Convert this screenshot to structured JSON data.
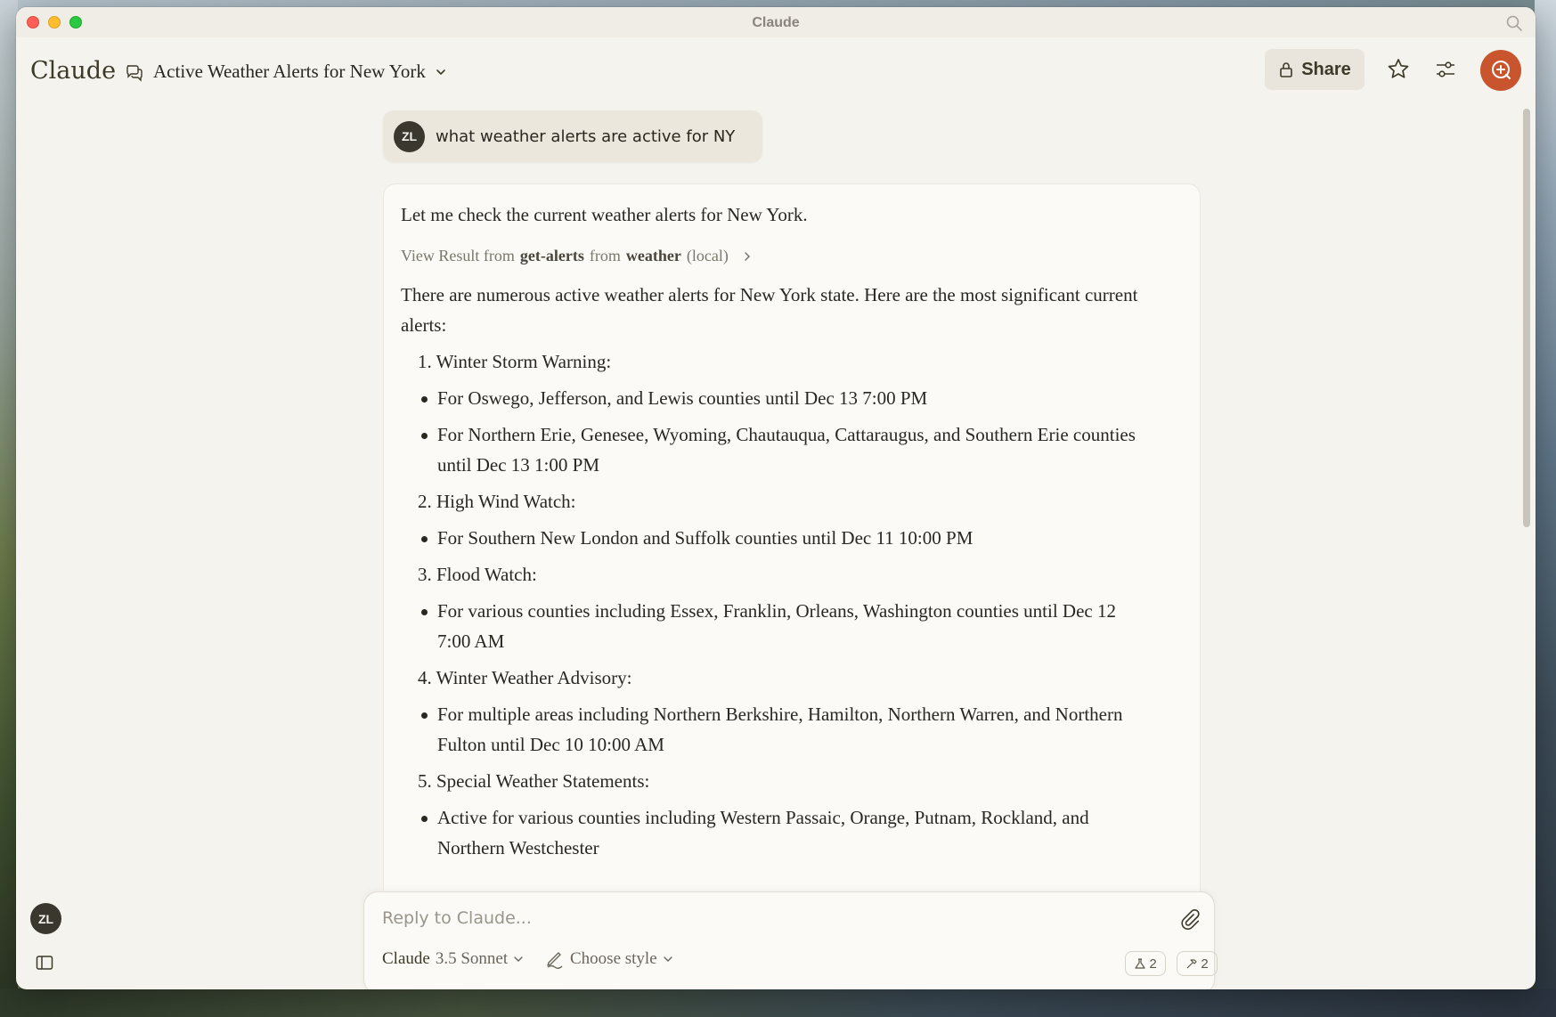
{
  "window": {
    "title": "Claude"
  },
  "header": {
    "logo": "Claude",
    "conversation_title": "Active Weather Alerts for New York",
    "share_label": "Share"
  },
  "user_message": {
    "avatar_initials": "ZL",
    "text": "what weather alerts are active for NY"
  },
  "assistant_message": {
    "intro": "Let me check the current weather alerts for New York.",
    "tool_result": {
      "prefix": "View Result from",
      "tool": "get-alerts",
      "mid": "from",
      "server": "weather",
      "suffix": "(local)"
    },
    "summary": "There are numerous active weather alerts for New York state. Here are the most significant current alerts:",
    "alerts": [
      {
        "heading": "1. Winter Storm Warning:",
        "items": [
          "For Oswego, Jefferson, and Lewis counties until Dec 13 7:00 PM",
          "For Northern Erie, Genesee, Wyoming, Chautauqua, Cattaraugus, and Southern Erie counties until Dec 13 1:00 PM"
        ]
      },
      {
        "heading": "2. High Wind Watch:",
        "items": [
          "For Southern New London and Suffolk counties until Dec 11 10:00 PM"
        ]
      },
      {
        "heading": "3. Flood Watch:",
        "items": [
          "For various counties including Essex, Franklin, Orleans, Washington counties until Dec 12 7:00 AM"
        ]
      },
      {
        "heading": "4. Winter Weather Advisory:",
        "items": [
          "For multiple areas including Northern Berkshire, Hamilton, Northern Warren, and Northern Fulton until Dec 10 10:00 AM"
        ]
      },
      {
        "heading": "5. Special Weather Statements:",
        "items": [
          "Active for various counties including Western Passaic, Orange, Putnam, Rockland, and Northern Westchester"
        ]
      }
    ]
  },
  "composer": {
    "placeholder": "Reply to Claude...",
    "model_name": "Claude",
    "model_version": "3.5 Sonnet",
    "style_label": "Choose style",
    "tools_count": "2",
    "integrations_count": "2"
  },
  "sidebar": {
    "user_initials": "ZL"
  },
  "colors": {
    "accent": "#c9552f",
    "background": "#f5f3ee",
    "card": "#fbfaf7"
  }
}
